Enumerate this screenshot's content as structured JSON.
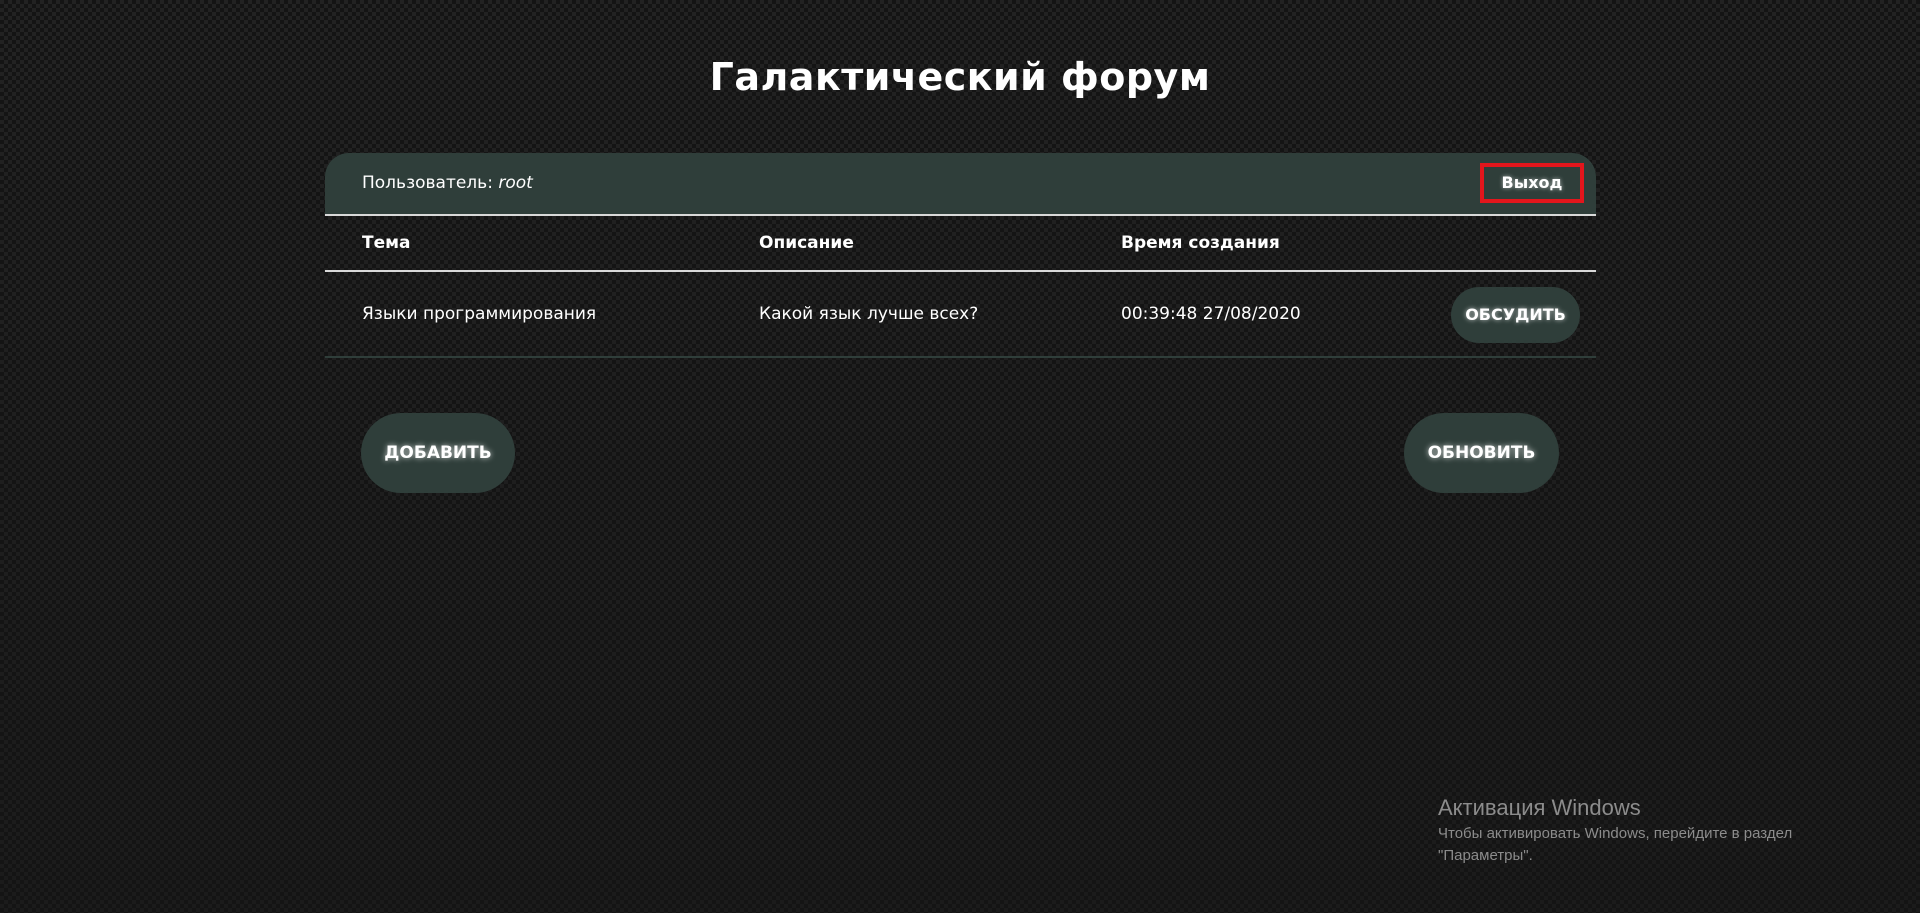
{
  "page": {
    "title": "Галактический форум"
  },
  "user_bar": {
    "label": "Пользователь:",
    "username": "root",
    "logout_label": "Выход"
  },
  "table": {
    "headers": {
      "topic": "Тема",
      "description": "Описание",
      "created": "Время создания"
    },
    "rows": [
      {
        "topic": "Языки программирования",
        "description": "Какой язык лучше всех?",
        "created": "00:39:48 27/08/2020",
        "action_label": "ОБСУДИТЬ"
      }
    ]
  },
  "actions": {
    "add_label": "ДОБАВИТЬ",
    "refresh_label": "ОБНОВИТЬ"
  },
  "windows_activation": {
    "title": "Активация Windows",
    "line1": "Чтобы активировать Windows, перейдите в раздел",
    "line2": "\"Параметры\"."
  },
  "colors": {
    "panel": "#2f3e3a",
    "highlight_border": "#e3161c",
    "text": "#ffffff"
  }
}
